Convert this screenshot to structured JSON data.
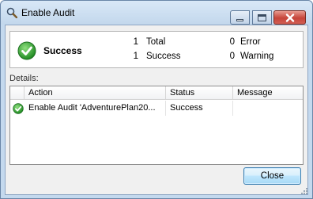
{
  "window": {
    "title": "Enable Audit"
  },
  "summary": {
    "status": "Success",
    "total_count": "1",
    "total_label": "Total",
    "success_count": "1",
    "success_label": "Success",
    "error_count": "0",
    "error_label": "Error",
    "warning_count": "0",
    "warning_label": "Warning"
  },
  "details": {
    "label": "Details:",
    "columns": [
      "Action",
      "Status",
      "Message"
    ],
    "rows": [
      {
        "action": "Enable Audit 'AdventurePlan20...",
        "status": "Success",
        "message": ""
      }
    ]
  },
  "buttons": {
    "close_label": "Close"
  },
  "colors": {
    "success_green": "#2e9e2e",
    "title_bg": "#c4d9ee",
    "close_red": "#c6453a"
  },
  "icons": {
    "title": "magnifier-icon",
    "summary": "success-check-icon",
    "row": "success-check-icon"
  }
}
